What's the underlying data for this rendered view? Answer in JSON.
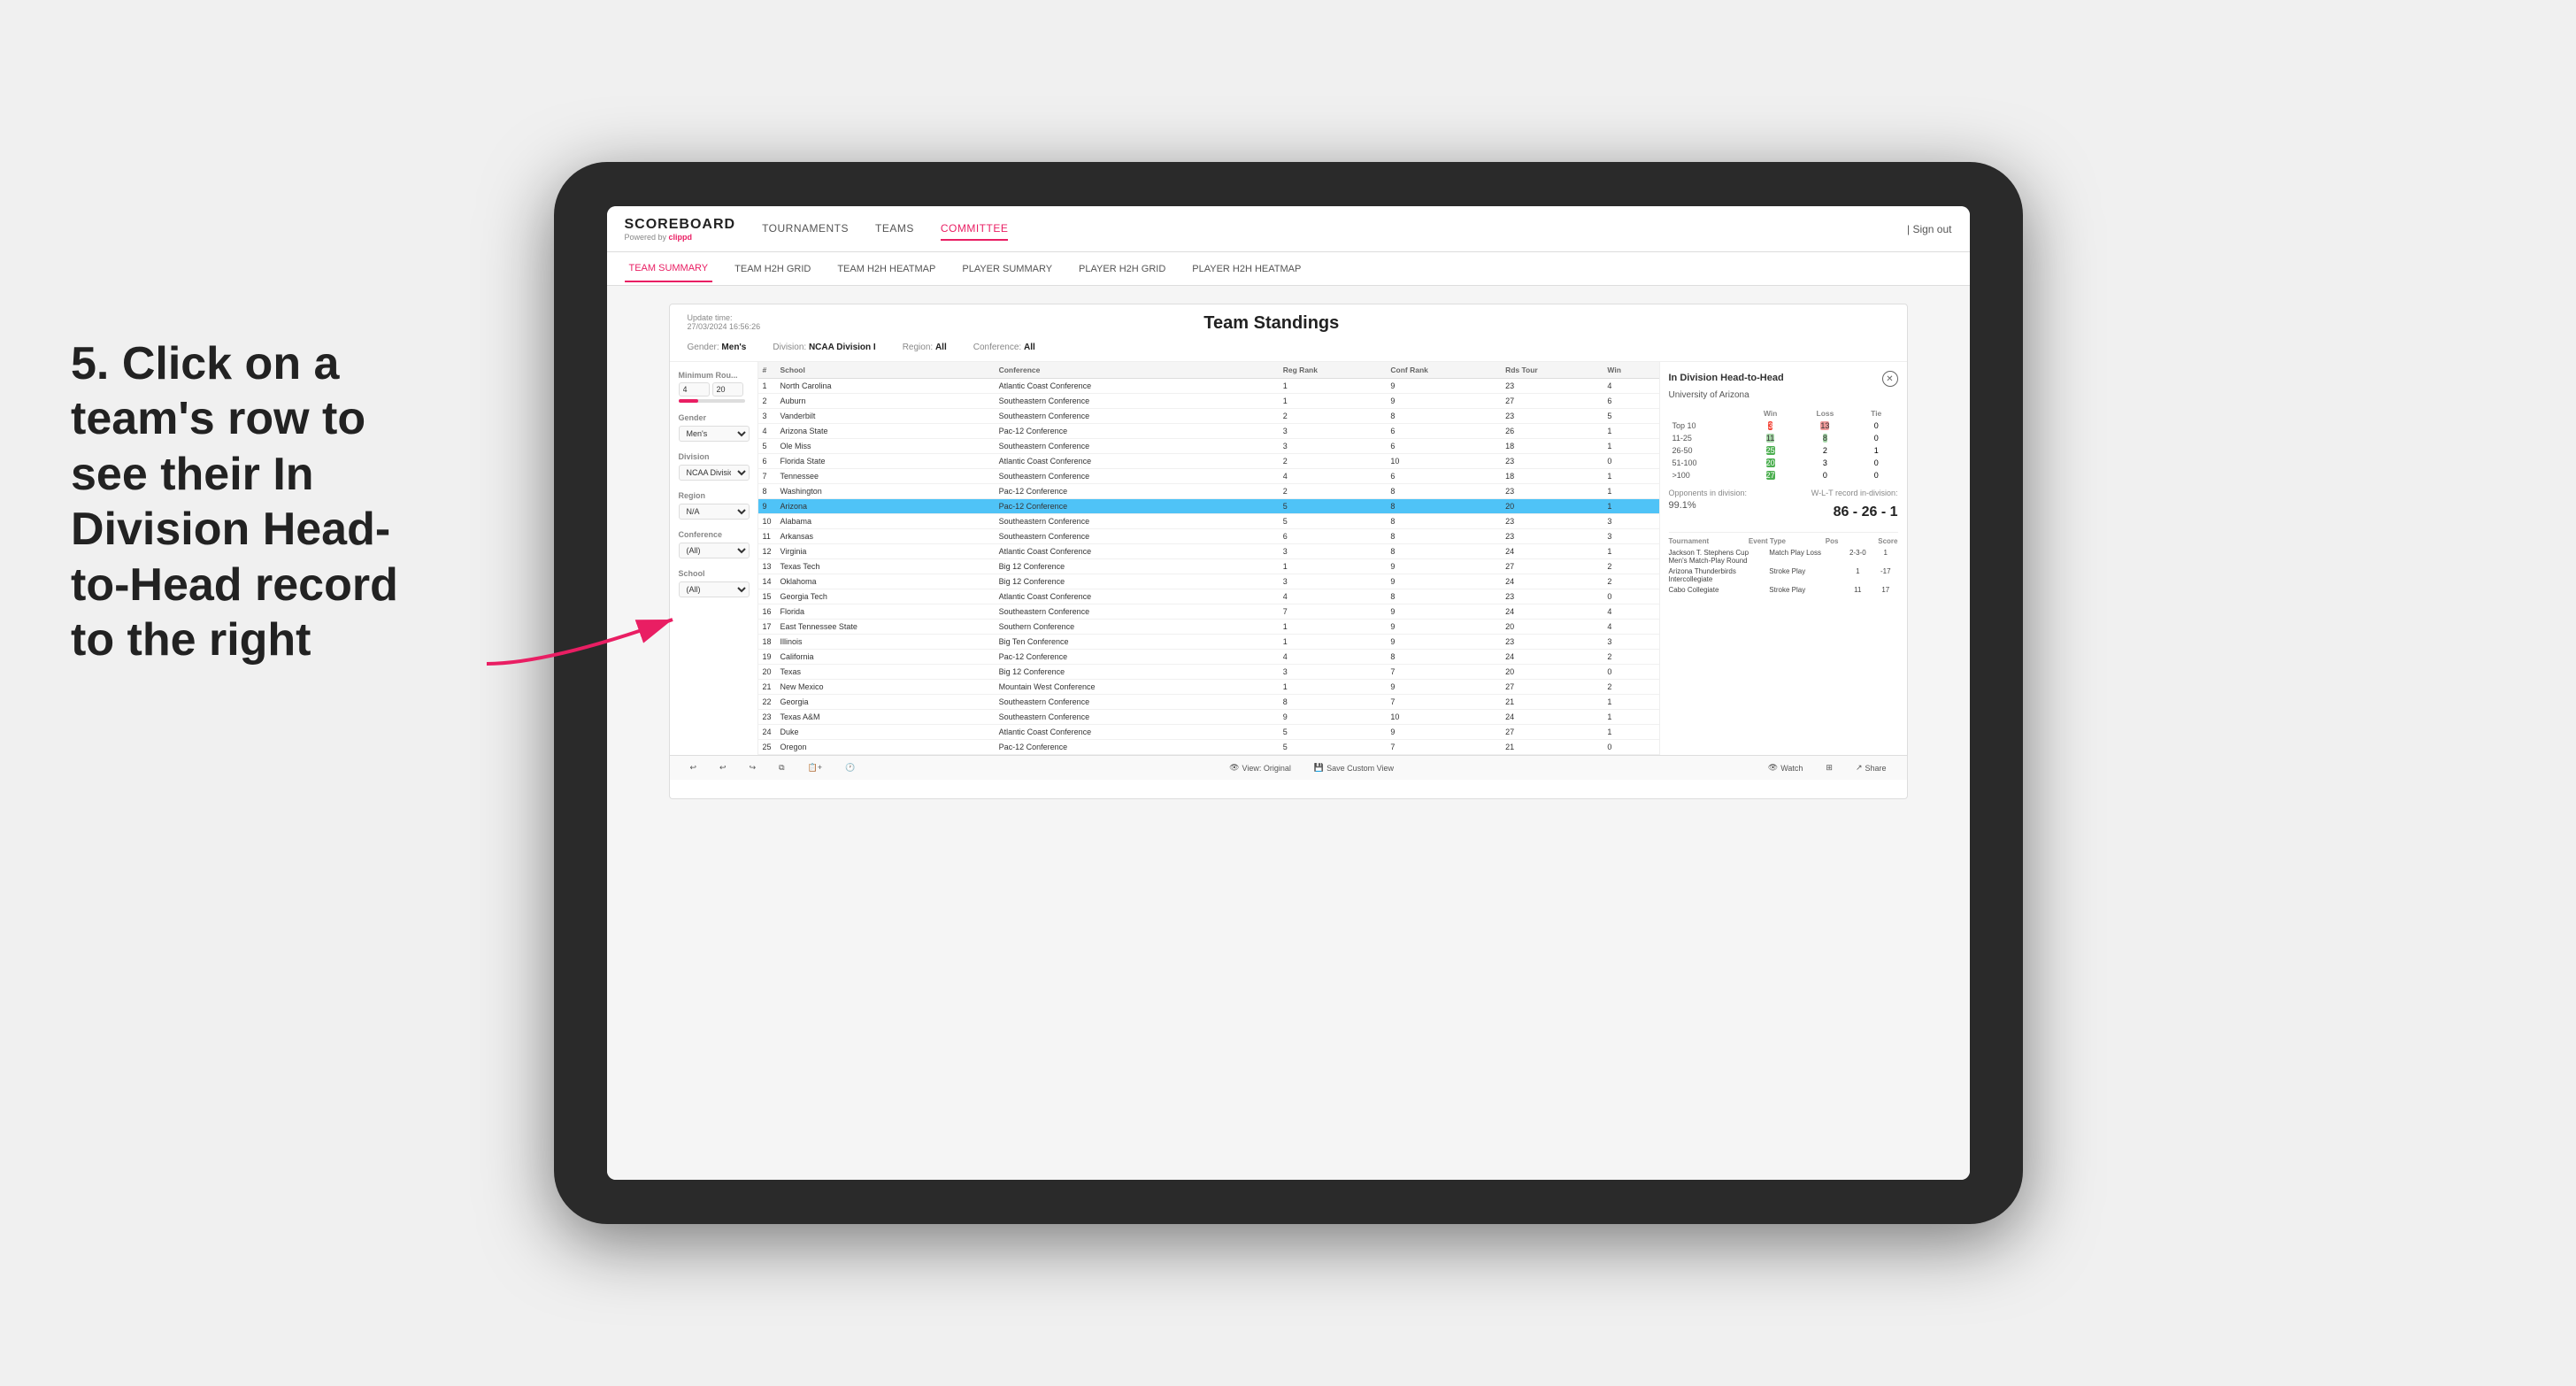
{
  "instruction": {
    "text": "5. Click on a team's row to see their In Division Head-to-Head record to the right"
  },
  "nav": {
    "logo": "SCOREBOARD",
    "powered_by": "Powered by",
    "clippd": "clippd",
    "items": [
      {
        "label": "TOURNAMENTS",
        "active": false
      },
      {
        "label": "TEAMS",
        "active": false
      },
      {
        "label": "COMMITTEE",
        "active": true
      }
    ],
    "sign_out": "Sign out"
  },
  "sub_nav": {
    "items": [
      {
        "label": "TEAM SUMMARY",
        "active": true
      },
      {
        "label": "TEAM H2H GRID",
        "active": false
      },
      {
        "label": "TEAM H2H HEATMAP",
        "active": false
      },
      {
        "label": "PLAYER SUMMARY",
        "active": false
      },
      {
        "label": "PLAYER H2H GRID",
        "active": false
      },
      {
        "label": "PLAYER H2H HEATMAP",
        "active": false
      }
    ]
  },
  "panel": {
    "update_time_label": "Update time:",
    "update_time_value": "27/03/2024 16:56:26",
    "title": "Team Standings",
    "gender_label": "Gender:",
    "gender_value": "Men's",
    "division_label": "Division:",
    "division_value": "NCAA Division I",
    "region_label": "Region:",
    "region_value": "All",
    "conference_label": "Conference:",
    "conference_value": "All"
  },
  "filters": {
    "minimum_rounds_label": "Minimum Rou...",
    "min_val": "4",
    "max_val": "20",
    "gender_label": "Gender",
    "gender_value": "Men's",
    "division_label": "Division",
    "division_value": "NCAA Division I",
    "region_label": "Region",
    "region_value": "N/A",
    "conference_label": "Conference",
    "conference_value": "(All)",
    "school_label": "School",
    "school_value": "(All)"
  },
  "table": {
    "headers": [
      "#",
      "School",
      "Conference",
      "Reg Rank",
      "Conf Rank",
      "Rds Tour",
      "Win"
    ],
    "rows": [
      {
        "num": "1",
        "school": "North Carolina",
        "conference": "Atlantic Coast Conference",
        "reg_rank": "1",
        "conf_rank": "9",
        "rds": "23",
        "win": "4",
        "highlighted": false
      },
      {
        "num": "2",
        "school": "Auburn",
        "conference": "Southeastern Conference",
        "reg_rank": "1",
        "conf_rank": "9",
        "rds": "27",
        "win": "6",
        "highlighted": false
      },
      {
        "num": "3",
        "school": "Vanderbilt",
        "conference": "Southeastern Conference",
        "reg_rank": "2",
        "conf_rank": "8",
        "rds": "23",
        "win": "5",
        "highlighted": false
      },
      {
        "num": "4",
        "school": "Arizona State",
        "conference": "Pac-12 Conference",
        "reg_rank": "3",
        "conf_rank": "6",
        "rds": "26",
        "win": "1",
        "highlighted": false
      },
      {
        "num": "5",
        "school": "Ole Miss",
        "conference": "Southeastern Conference",
        "reg_rank": "3",
        "conf_rank": "6",
        "rds": "18",
        "win": "1",
        "highlighted": false
      },
      {
        "num": "6",
        "school": "Florida State",
        "conference": "Atlantic Coast Conference",
        "reg_rank": "2",
        "conf_rank": "10",
        "rds": "23",
        "win": "0",
        "highlighted": false
      },
      {
        "num": "7",
        "school": "Tennessee",
        "conference": "Southeastern Conference",
        "reg_rank": "4",
        "conf_rank": "6",
        "rds": "18",
        "win": "1",
        "highlighted": false
      },
      {
        "num": "8",
        "school": "Washington",
        "conference": "Pac-12 Conference",
        "reg_rank": "2",
        "conf_rank": "8",
        "rds": "23",
        "win": "1",
        "highlighted": false
      },
      {
        "num": "9",
        "school": "Arizona",
        "conference": "Pac-12 Conference",
        "reg_rank": "5",
        "conf_rank": "8",
        "rds": "20",
        "win": "1",
        "highlighted": true
      },
      {
        "num": "10",
        "school": "Alabama",
        "conference": "Southeastern Conference",
        "reg_rank": "5",
        "conf_rank": "8",
        "rds": "23",
        "win": "3",
        "highlighted": false
      },
      {
        "num": "11",
        "school": "Arkansas",
        "conference": "Southeastern Conference",
        "reg_rank": "6",
        "conf_rank": "8",
        "rds": "23",
        "win": "3",
        "highlighted": false
      },
      {
        "num": "12",
        "school": "Virginia",
        "conference": "Atlantic Coast Conference",
        "reg_rank": "3",
        "conf_rank": "8",
        "rds": "24",
        "win": "1",
        "highlighted": false
      },
      {
        "num": "13",
        "school": "Texas Tech",
        "conference": "Big 12 Conference",
        "reg_rank": "1",
        "conf_rank": "9",
        "rds": "27",
        "win": "2",
        "highlighted": false
      },
      {
        "num": "14",
        "school": "Oklahoma",
        "conference": "Big 12 Conference",
        "reg_rank": "3",
        "conf_rank": "9",
        "rds": "24",
        "win": "2",
        "highlighted": false
      },
      {
        "num": "15",
        "school": "Georgia Tech",
        "conference": "Atlantic Coast Conference",
        "reg_rank": "4",
        "conf_rank": "8",
        "rds": "23",
        "win": "0",
        "highlighted": false
      },
      {
        "num": "16",
        "school": "Florida",
        "conference": "Southeastern Conference",
        "reg_rank": "7",
        "conf_rank": "9",
        "rds": "24",
        "win": "4",
        "highlighted": false
      },
      {
        "num": "17",
        "school": "East Tennessee State",
        "conference": "Southern Conference",
        "reg_rank": "1",
        "conf_rank": "9",
        "rds": "20",
        "win": "4",
        "highlighted": false
      },
      {
        "num": "18",
        "school": "Illinois",
        "conference": "Big Ten Conference",
        "reg_rank": "1",
        "conf_rank": "9",
        "rds": "23",
        "win": "3",
        "highlighted": false
      },
      {
        "num": "19",
        "school": "California",
        "conference": "Pac-12 Conference",
        "reg_rank": "4",
        "conf_rank": "8",
        "rds": "24",
        "win": "2",
        "highlighted": false
      },
      {
        "num": "20",
        "school": "Texas",
        "conference": "Big 12 Conference",
        "reg_rank": "3",
        "conf_rank": "7",
        "rds": "20",
        "win": "0",
        "highlighted": false
      },
      {
        "num": "21",
        "school": "New Mexico",
        "conference": "Mountain West Conference",
        "reg_rank": "1",
        "conf_rank": "9",
        "rds": "27",
        "win": "2",
        "highlighted": false
      },
      {
        "num": "22",
        "school": "Georgia",
        "conference": "Southeastern Conference",
        "reg_rank": "8",
        "conf_rank": "7",
        "rds": "21",
        "win": "1",
        "highlighted": false
      },
      {
        "num": "23",
        "school": "Texas A&M",
        "conference": "Southeastern Conference",
        "reg_rank": "9",
        "conf_rank": "10",
        "rds": "24",
        "win": "1",
        "highlighted": false
      },
      {
        "num": "24",
        "school": "Duke",
        "conference": "Atlantic Coast Conference",
        "reg_rank": "5",
        "conf_rank": "9",
        "rds": "27",
        "win": "1",
        "highlighted": false
      },
      {
        "num": "25",
        "school": "Oregon",
        "conference": "Pac-12 Conference",
        "reg_rank": "5",
        "conf_rank": "7",
        "rds": "21",
        "win": "0",
        "highlighted": false
      }
    ]
  },
  "h2h": {
    "title": "In Division Head-to-Head",
    "school": "University of Arizona",
    "win_label": "Win",
    "loss_label": "Loss",
    "tie_label": "Tie",
    "rows": [
      {
        "range": "Top 10",
        "win": "3",
        "loss": "13",
        "tie": "0"
      },
      {
        "range": "11-25",
        "win": "11",
        "loss": "8",
        "tie": "0"
      },
      {
        "range": "26-50",
        "win": "25",
        "loss": "2",
        "tie": "1"
      },
      {
        "range": "51-100",
        "win": "20",
        "loss": "3",
        "tie": "0"
      },
      {
        "range": ">100",
        "win": "27",
        "loss": "0",
        "tie": "0"
      }
    ],
    "opponents_label": "Opponents in division:",
    "opponents_value": "99.1%",
    "wlt_label": "W-L-T record in-division:",
    "wlt_value": "86 - 26 - 1",
    "tournaments": [
      {
        "name": "Jackson T. Stephens Cup Men's Match-Play Round",
        "event_type": "Match Play",
        "result": "Loss",
        "pos": "2-3-0",
        "score": "1"
      },
      {
        "name": "Arizona Thunderbirds Intercollegiate",
        "event_type": "Stroke Play",
        "result": "",
        "pos": "1",
        "score": "-17"
      },
      {
        "name": "Cabo Collegiate",
        "event_type": "Stroke Play",
        "result": "",
        "pos": "11",
        "score": "17"
      }
    ],
    "tournament_col_labels": {
      "name": "Tournament",
      "event_type": "Event Type",
      "pos": "Pos",
      "score": "Score"
    }
  },
  "toolbar": {
    "undo": "↩",
    "redo": "↪",
    "view_original": "View: Original",
    "save_custom": "Save Custom View",
    "watch": "Watch",
    "share": "Share"
  }
}
